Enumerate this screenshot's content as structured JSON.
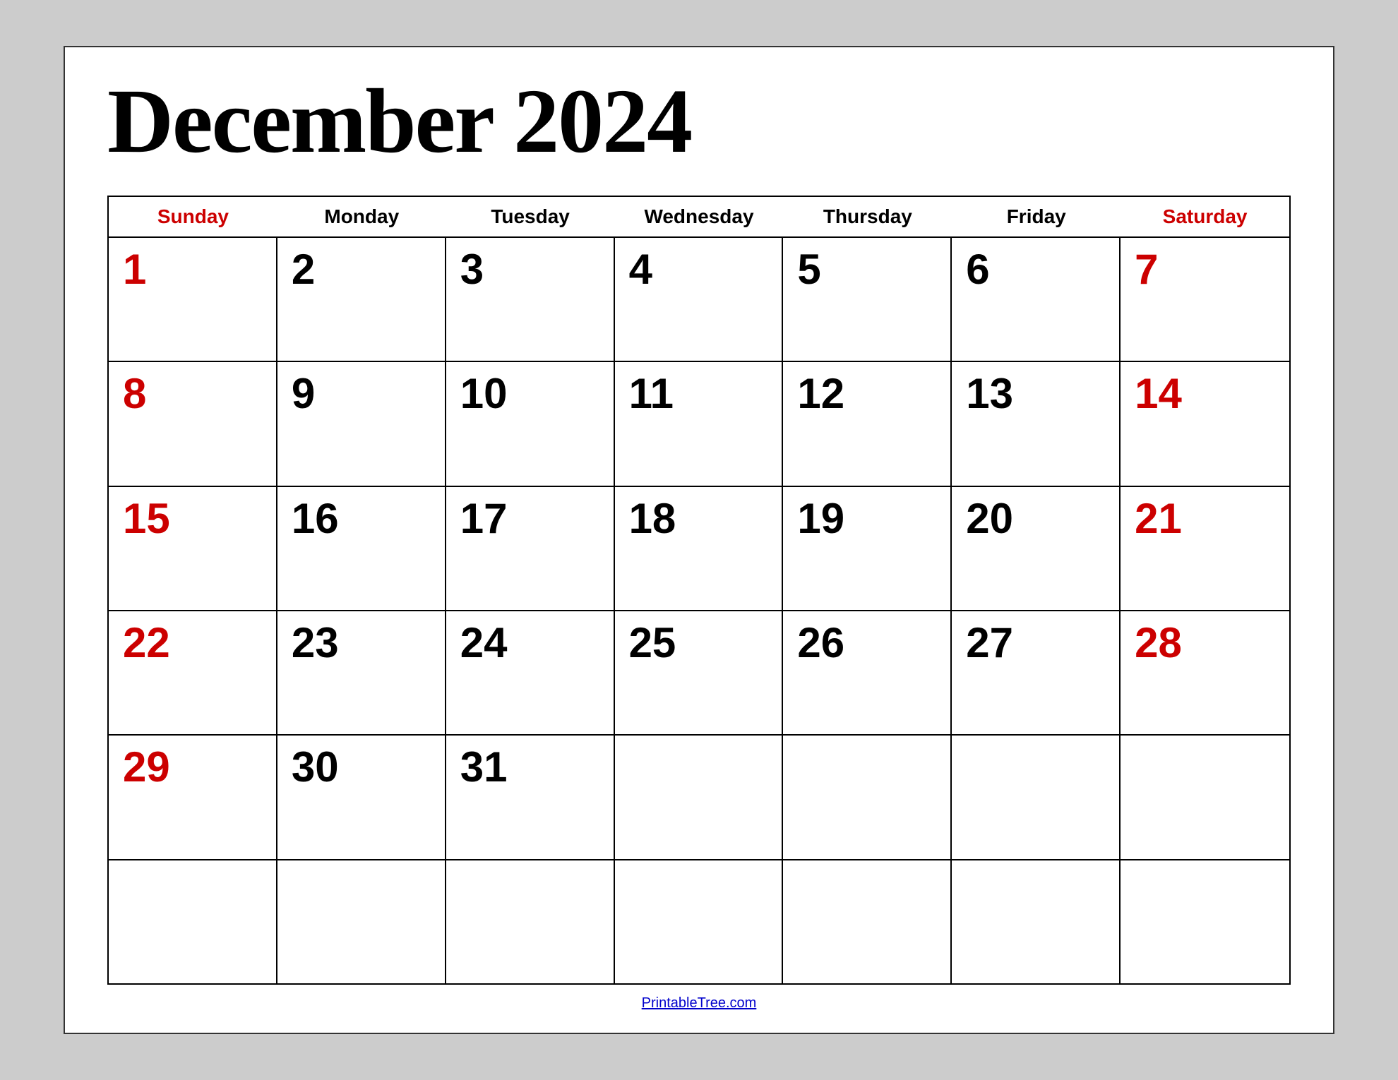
{
  "title": "December 2024",
  "colors": {
    "red": "#cc0000",
    "black": "#000000",
    "link": "#0000cc"
  },
  "headers": [
    {
      "label": "Sunday",
      "type": "weekend"
    },
    {
      "label": "Monday",
      "type": "weekday"
    },
    {
      "label": "Tuesday",
      "type": "weekday"
    },
    {
      "label": "Wednesday",
      "type": "weekday"
    },
    {
      "label": "Thursday",
      "type": "weekday"
    },
    {
      "label": "Friday",
      "type": "weekday"
    },
    {
      "label": "Saturday",
      "type": "weekend"
    }
  ],
  "rows": [
    [
      {
        "day": "1",
        "color": "red"
      },
      {
        "day": "2",
        "color": "black"
      },
      {
        "day": "3",
        "color": "black"
      },
      {
        "day": "4",
        "color": "black"
      },
      {
        "day": "5",
        "color": "black"
      },
      {
        "day": "6",
        "color": "black"
      },
      {
        "day": "7",
        "color": "red"
      }
    ],
    [
      {
        "day": "8",
        "color": "red"
      },
      {
        "day": "9",
        "color": "black"
      },
      {
        "day": "10",
        "color": "black"
      },
      {
        "day": "11",
        "color": "black"
      },
      {
        "day": "12",
        "color": "black"
      },
      {
        "day": "13",
        "color": "black"
      },
      {
        "day": "14",
        "color": "red"
      }
    ],
    [
      {
        "day": "15",
        "color": "red"
      },
      {
        "day": "16",
        "color": "black"
      },
      {
        "day": "17",
        "color": "black"
      },
      {
        "day": "18",
        "color": "black"
      },
      {
        "day": "19",
        "color": "black"
      },
      {
        "day": "20",
        "color": "black"
      },
      {
        "day": "21",
        "color": "red"
      }
    ],
    [
      {
        "day": "22",
        "color": "red"
      },
      {
        "day": "23",
        "color": "black"
      },
      {
        "day": "24",
        "color": "black"
      },
      {
        "day": "25",
        "color": "black"
      },
      {
        "day": "26",
        "color": "black"
      },
      {
        "day": "27",
        "color": "black"
      },
      {
        "day": "28",
        "color": "red"
      }
    ],
    [
      {
        "day": "29",
        "color": "red"
      },
      {
        "day": "30",
        "color": "black"
      },
      {
        "day": "31",
        "color": "black"
      },
      {
        "day": "",
        "color": "empty"
      },
      {
        "day": "",
        "color": "empty"
      },
      {
        "day": "",
        "color": "empty"
      },
      {
        "day": "",
        "color": "empty"
      }
    ],
    [
      {
        "day": "",
        "color": "empty"
      },
      {
        "day": "",
        "color": "empty"
      },
      {
        "day": "",
        "color": "empty"
      },
      {
        "day": "",
        "color": "empty"
      },
      {
        "day": "",
        "color": "empty"
      },
      {
        "day": "",
        "color": "empty"
      },
      {
        "day": "",
        "color": "empty"
      }
    ]
  ],
  "footer": {
    "link_text": "PrintableTree.com",
    "link_url": "#"
  }
}
